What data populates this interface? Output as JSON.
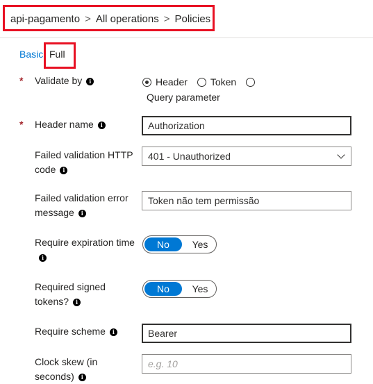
{
  "breadcrumb": {
    "items": [
      "api-pagamento",
      "All operations",
      "Policies"
    ],
    "separator": ">"
  },
  "tabs": {
    "basic": "Basic",
    "full": "Full"
  },
  "required_marker": "*",
  "info_glyph": "i",
  "validate_by": {
    "label": "Validate by",
    "options": [
      "Header",
      "Token",
      "Query parameter"
    ],
    "selected": "Header"
  },
  "header_name": {
    "label": "Header name",
    "value": "Authorization"
  },
  "failed_code": {
    "label": "Failed validation HTTP code",
    "value": "401 - Unauthorized"
  },
  "failed_message": {
    "label": "Failed validation error message",
    "value": "Token não tem permissão"
  },
  "require_expiration": {
    "label": "Require expiration time",
    "on_label": "No",
    "off_label": "Yes"
  },
  "required_signed": {
    "label": "Required signed tokens?",
    "on_label": "No",
    "off_label": "Yes"
  },
  "require_scheme": {
    "label": "Require scheme",
    "value": "Bearer"
  },
  "clock_skew": {
    "label": "Clock skew (in seconds)",
    "placeholder": "e.g. 10"
  },
  "colors": {
    "accent": "#0078d4",
    "highlight": "#e81123",
    "required": "#a4262c"
  }
}
